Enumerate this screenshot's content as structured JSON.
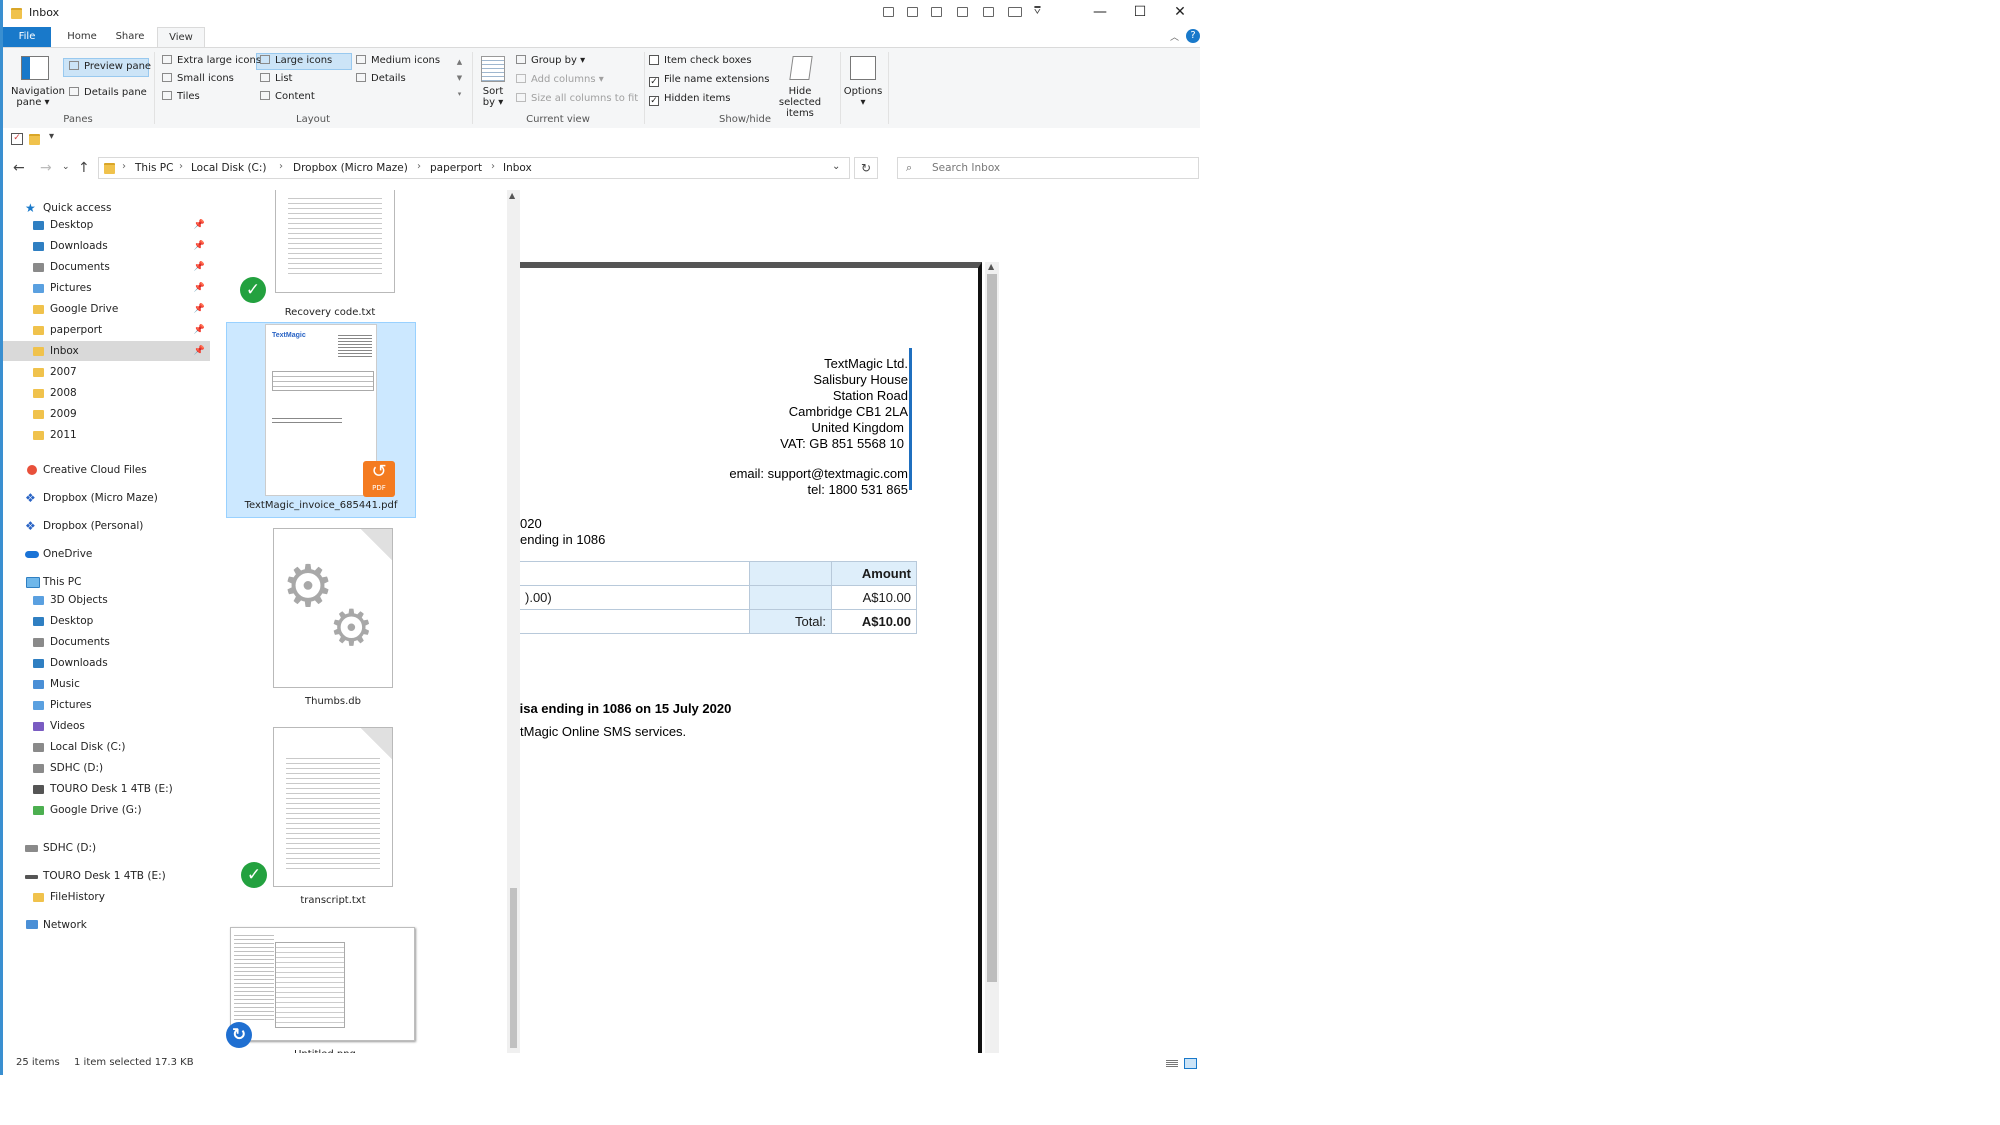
{
  "window": {
    "title": "Inbox",
    "controls": {
      "minimize": "—",
      "maximize": "☐",
      "close": "✕"
    }
  },
  "ribbon": {
    "tabs": [
      "File",
      "Home",
      "Share",
      "View"
    ],
    "active_tab": "View",
    "panes": {
      "navigation_pane": "Navigation pane",
      "preview_pane": "Preview pane",
      "details_pane": "Details pane",
      "label": "Panes"
    },
    "layout": {
      "items": [
        "Extra large icons",
        "Large icons",
        "Medium icons",
        "Small icons",
        "List",
        "Details",
        "Tiles",
        "Content"
      ],
      "selected": "Large icons",
      "label": "Layout"
    },
    "current_view": {
      "sort_by": "Sort by",
      "group_by": "Group by",
      "add_columns": "Add columns",
      "size_columns": "Size all columns to fit",
      "label": "Current view"
    },
    "show_hide": {
      "item_check_boxes": "Item check boxes",
      "file_name_extensions": "File name extensions",
      "hidden_items": "Hidden items",
      "hide_selected": "Hide selected items",
      "label": "Show/hide"
    },
    "options": "Options"
  },
  "address": {
    "crumbs": [
      "This PC",
      "Local Disk (C:)",
      "Dropbox (Micro Maze)",
      "paperport",
      "Inbox"
    ],
    "search_placeholder": "Search Inbox"
  },
  "nav": {
    "quick_access": "Quick access",
    "quick_items": [
      "Desktop",
      "Downloads",
      "Documents",
      "Pictures",
      "Google Drive",
      "paperport",
      "Inbox",
      "2007",
      "2008",
      "2009",
      "2011"
    ],
    "creative_cloud": "Creative Cloud Files",
    "dropbox_micro": "Dropbox (Micro Maze)",
    "dropbox_personal": "Dropbox (Personal)",
    "onedrive": "OneDrive",
    "this_pc": "This PC",
    "pc_items": [
      "3D Objects",
      "Desktop",
      "Documents",
      "Downloads",
      "Music",
      "Pictures",
      "Videos",
      "Local Disk (C:)",
      "SDHC (D:)",
      "TOURO Desk 1 4TB (E:)",
      "Google Drive (G:)"
    ],
    "sdhc": "SDHC (D:)",
    "touro": "TOURO Desk 1 4TB (E:)",
    "filehistory": "FileHistory",
    "network": "Network"
  },
  "files": {
    "items": [
      "Recovery code.txt",
      "TextMagic_invoice_685441.pdf",
      "Thumbs.db",
      "transcript.txt",
      "Untitled.png"
    ],
    "pdf_badge": "PDF",
    "thumb_brand": "TextMagic"
  },
  "preview": {
    "company": [
      "TextMagic Ltd.",
      "Salisbury House",
      "Station Road",
      "Cambridge CB1 2LA",
      "United Kingdom",
      "VAT: GB 851 5568 10"
    ],
    "contact": [
      "email: support@textmagic.com",
      "tel: 1800 531 865"
    ],
    "date_fragment": "020",
    "card_fragment": "ending in 1086",
    "table": {
      "amount_header": "Amount",
      "row_fragment": ").00)",
      "row_amount": "A$10.00",
      "total_label": "Total:",
      "total_amount": "A$10.00"
    },
    "paid_line": "/isa ending in 1086 on 15 July 2020",
    "thanks_line": "tMagic Online SMS services."
  },
  "status": {
    "count": "25 items",
    "selection": "1 item selected  17.3 KB"
  },
  "colors": {
    "accent": "#1979ca",
    "selection": "#cce8ff",
    "check_badge": "#23a13f",
    "pdf_orange": "#f47b20"
  }
}
